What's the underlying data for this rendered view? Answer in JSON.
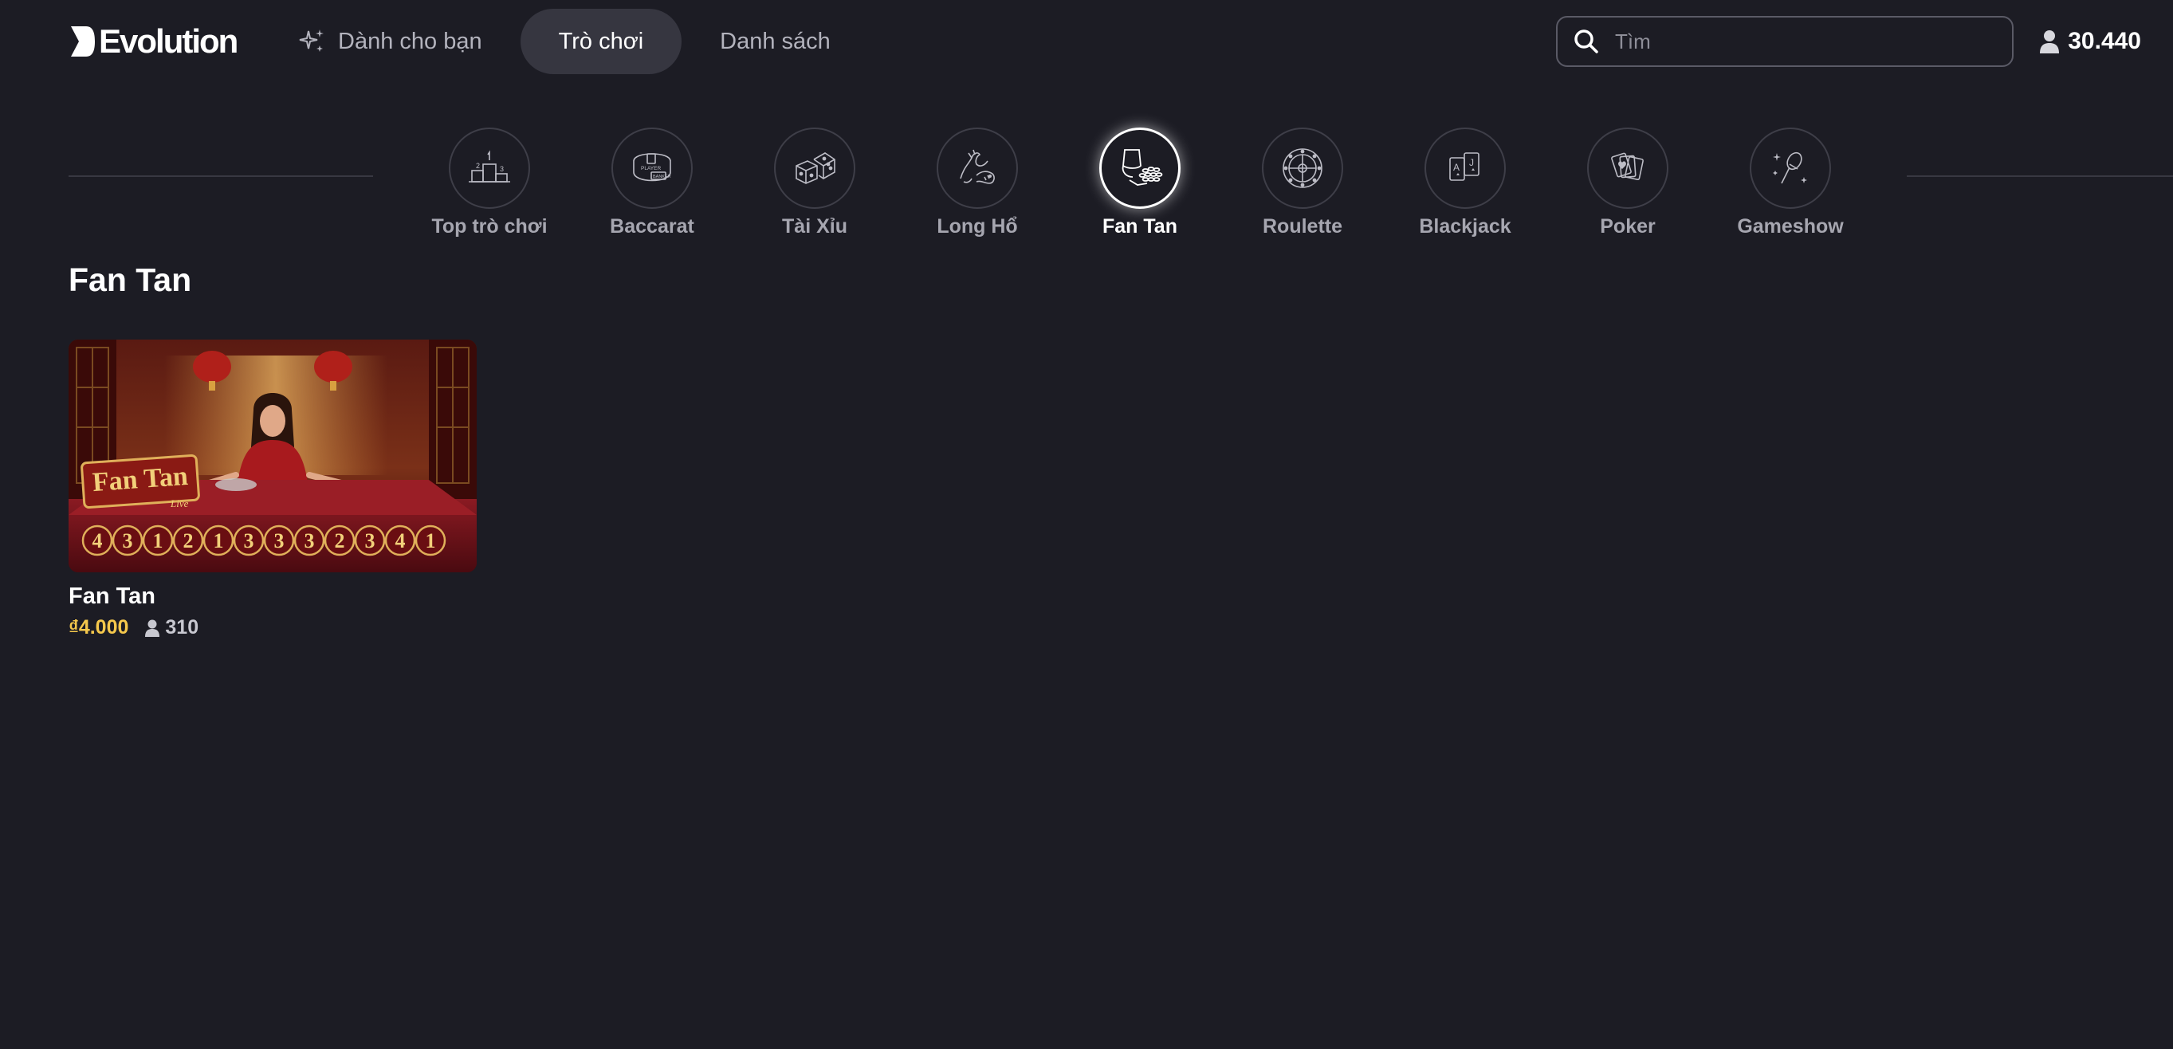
{
  "brand": {
    "name": "Evolution"
  },
  "nav": {
    "items": [
      {
        "label": "Dành cho bạn",
        "icon": "sparkles-icon",
        "active": false
      },
      {
        "label": "Trò chơi",
        "active": true
      },
      {
        "label": "Danh sách",
        "active": false
      }
    ]
  },
  "search": {
    "placeholder": "Tìm",
    "value": ""
  },
  "balance": {
    "value": "30.440",
    "icon": "user-icon"
  },
  "categories": [
    {
      "label": "Top trò chơi",
      "icon": "podium-icon",
      "active": false
    },
    {
      "label": "Baccarat",
      "icon": "baccarat-table-icon",
      "active": false
    },
    {
      "label": "Tài Xỉu",
      "icon": "dice-icon",
      "active": false
    },
    {
      "label": "Long Hổ",
      "icon": "dragon-tiger-icon",
      "active": false
    },
    {
      "label": "Fan Tan",
      "icon": "fan-tan-cup-icon",
      "active": true
    },
    {
      "label": "Roulette",
      "icon": "roulette-wheel-icon",
      "active": false
    },
    {
      "label": "Blackjack",
      "icon": "playing-cards-icon",
      "active": false
    },
    {
      "label": "Poker",
      "icon": "poker-cards-icon",
      "active": false
    },
    {
      "label": "Gameshow",
      "icon": "microphone-icon",
      "active": false
    }
  ],
  "section": {
    "title": "Fan Tan"
  },
  "games": [
    {
      "name": "Fan Tan",
      "bet": "₫4.000",
      "players": "310",
      "thumbnail": {
        "logo_text": "Fan Tan",
        "logo_subtext": "Live",
        "results": [
          "4",
          "3",
          "1",
          "2",
          "1",
          "3",
          "3",
          "3",
          "2",
          "3",
          "4",
          "1"
        ]
      }
    }
  ],
  "colors": {
    "background": "#1c1c24",
    "active_nav": "#363640",
    "bet_yellow": "#f5c84c",
    "muted_text": "#a6a6b0"
  }
}
